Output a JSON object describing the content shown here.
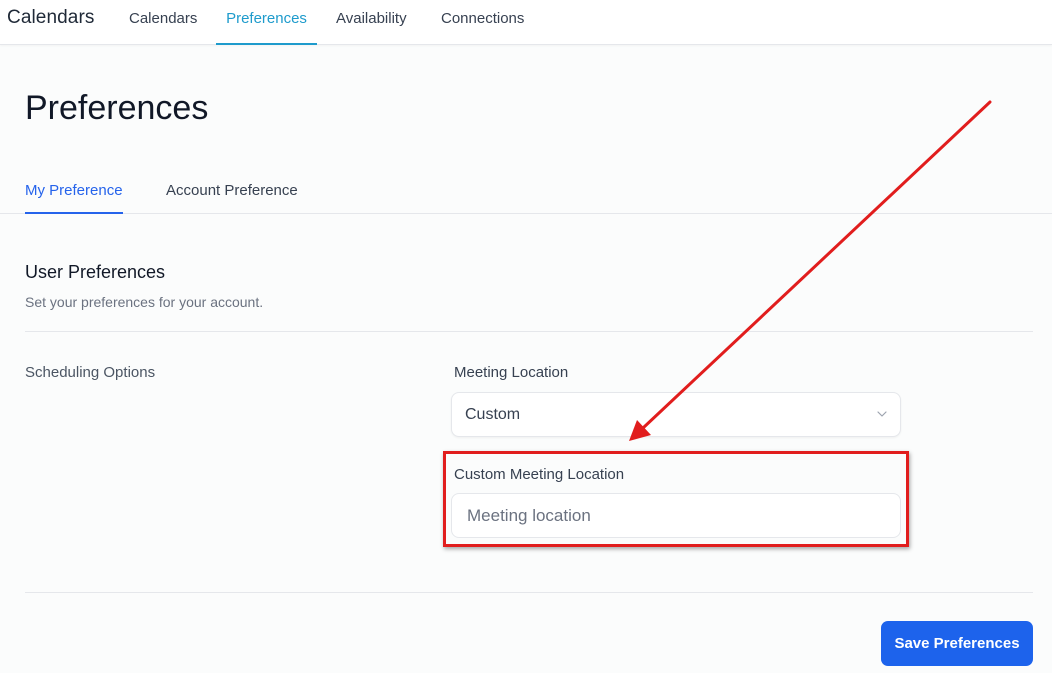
{
  "header": {
    "app_title": "Calendars",
    "tabs": [
      {
        "label": "Calendars",
        "active": false
      },
      {
        "label": "Preferences",
        "active": true
      },
      {
        "label": "Availability",
        "active": false
      },
      {
        "label": "Connections",
        "active": false
      }
    ]
  },
  "page": {
    "title": "Preferences",
    "subtabs": [
      {
        "label": "My Preference",
        "active": true
      },
      {
        "label": "Account Preference",
        "active": false
      }
    ]
  },
  "section": {
    "title": "User Preferences",
    "subtitle": "Set your preferences for your account."
  },
  "scheduling": {
    "label": "Scheduling Options",
    "meeting_location_label": "Meeting Location",
    "meeting_location_value": "Custom",
    "custom_location_label": "Custom Meeting Location",
    "custom_location_placeholder": "Meeting location",
    "custom_location_value": ""
  },
  "footer": {
    "save_label": "Save Preferences"
  },
  "icons": {
    "select": "chevron-down-icon"
  },
  "colors": {
    "accent_nav": "#1e9bcc",
    "accent_primary": "#1d63ec",
    "annotation": "#e11d1d"
  }
}
